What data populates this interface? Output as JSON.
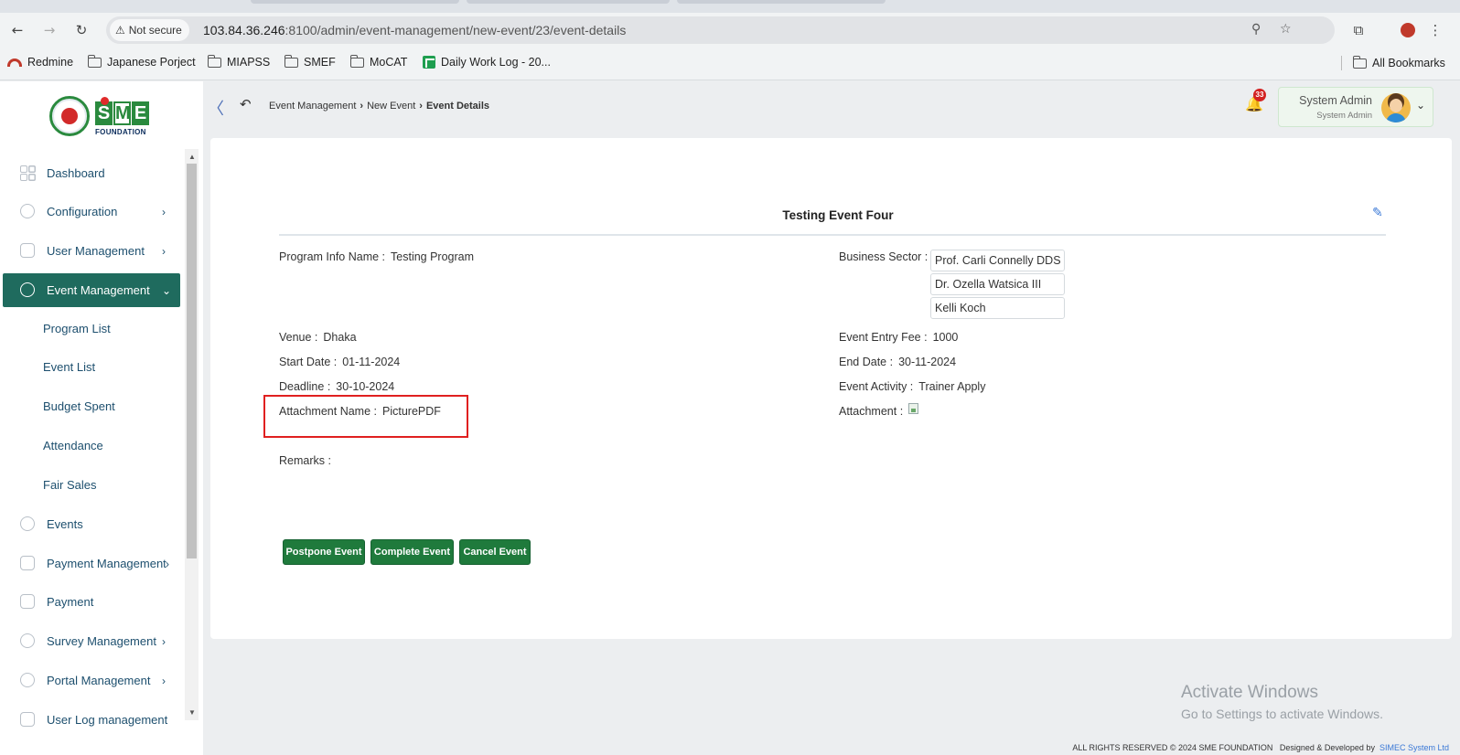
{
  "browser": {
    "security_label": "Not secure",
    "url_host": "103.84.36.246",
    "url_rest": ":8100/admin/event-management/new-event/23/event-details",
    "bookmarks": [
      "Redmine",
      "Japanese Porject",
      "MIAPSS",
      "SMEF",
      "MoCAT",
      "Daily Work Log - 20..."
    ],
    "all_bookmarks": "All Bookmarks"
  },
  "header": {
    "logo_text": "SME",
    "logo_subtext": "FOUNDATION",
    "collapse_glyph": "〈",
    "breadcrumb": [
      "Event Management",
      "New Event",
      "Event Details"
    ],
    "notification_count": "33",
    "user_name": "System Admin",
    "user_role": "System Admin"
  },
  "sidebar": {
    "items": [
      {
        "label": "Dashboard",
        "icon": "dashboard-icon"
      },
      {
        "label": "Configuration",
        "icon": "configuration-icon"
      },
      {
        "label": "User Management",
        "icon": "user-management-icon"
      },
      {
        "label": "Event Management",
        "icon": "event-management-icon"
      },
      {
        "label": "Events",
        "icon": "events-icon"
      },
      {
        "label": "Payment Management",
        "icon": "payment-management-icon"
      },
      {
        "label": "Payment",
        "icon": "payment-icon"
      },
      {
        "label": "Survey Management",
        "icon": "survey-management-icon"
      },
      {
        "label": "Portal Management",
        "icon": "portal-management-icon"
      },
      {
        "label": "User Log management",
        "icon": "user-log-icon"
      }
    ],
    "sub_items": [
      "Program List",
      "Event List",
      "Budget Spent",
      "Attendance",
      "Fair Sales"
    ]
  },
  "event": {
    "title": "Testing Event Four",
    "program_info_label": "Program Info Name :",
    "program_info_value": "Testing Program",
    "business_sector_label": "Business Sector :",
    "business_sectors": [
      "Prof. Carli Connelly DDS",
      "Dr. Ozella Watsica III",
      "Kelli Koch"
    ],
    "venue_label": "Venue :",
    "venue_value": "Dhaka",
    "entry_fee_label": "Event Entry Fee :",
    "entry_fee_value": "1000",
    "start_date_label": "Start Date :",
    "start_date_value": "01-11-2024",
    "end_date_label": "End Date :",
    "end_date_value": "30-11-2024",
    "deadline_label": "Deadline :",
    "deadline_value": "30-10-2024",
    "activity_label": "Event Activity :",
    "activity_value": "Trainer Apply",
    "attachment_name_label": "Attachment Name :",
    "attachment_name_value": "PicturePDF",
    "attachment_label": "Attachment :",
    "remarks_label": "Remarks :"
  },
  "actions": {
    "postpone": "Postpone Event",
    "complete": "Complete Event",
    "cancel": "Cancel Event"
  },
  "watermark": {
    "line1": "Activate Windows",
    "line2": "Go to Settings to activate Windows."
  },
  "footer": {
    "copyright": "ALL RIGHTS RESERVED © 2024 SME FOUNDATION",
    "designed_by": "Designed & Developed by",
    "company": "SIMEC System Ltd"
  },
  "colors": {
    "sidebar_active": "#1f6b5e",
    "action_button": "#1f7a3c",
    "highlight_border": "#e02020",
    "badge": "#d32222"
  }
}
